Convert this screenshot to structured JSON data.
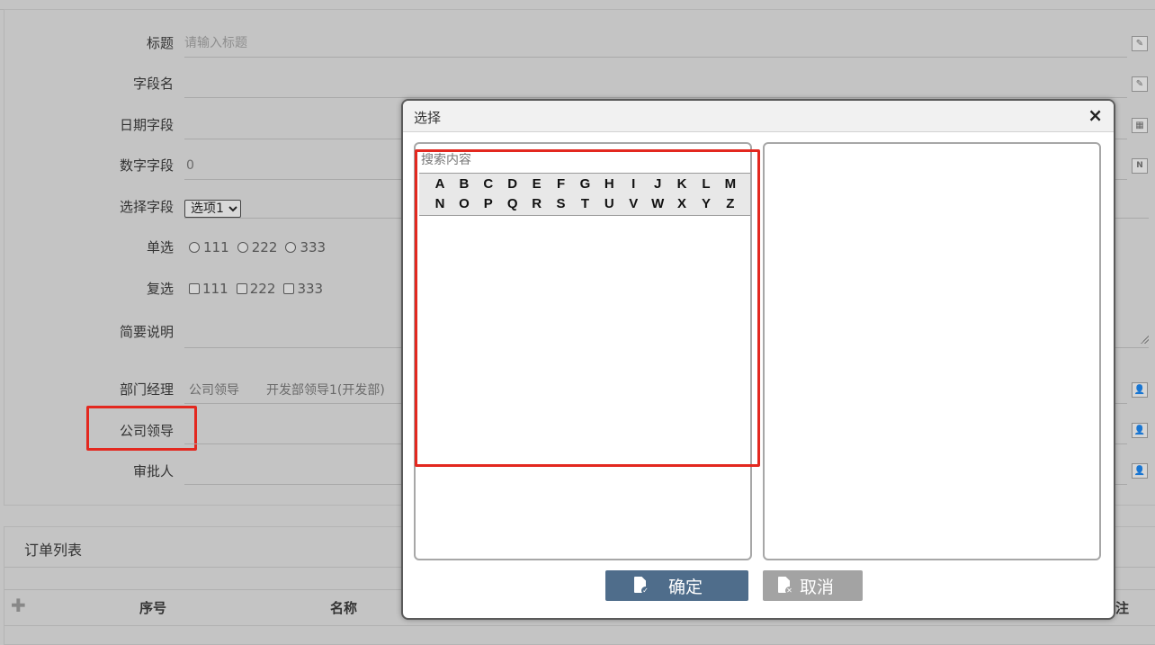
{
  "form": {
    "fields": [
      {
        "label": "标题",
        "placeholder": "请输入标题",
        "icon": "edit-icon"
      },
      {
        "label": "字段名",
        "value": "",
        "icon": "edit-icon"
      },
      {
        "label": "日期字段",
        "value": "",
        "icon": "calendar-icon"
      },
      {
        "label": "数字字段",
        "value": "0",
        "icon": "number-icon"
      },
      {
        "label": "选择字段",
        "select_value": "选项1"
      },
      {
        "label": "单选",
        "options": [
          "111",
          "222",
          "333"
        ]
      },
      {
        "label": "复选",
        "options": [
          "111",
          "222",
          "333"
        ]
      },
      {
        "label": "简要说明",
        "value": ""
      },
      {
        "label": "部门经理",
        "values": [
          "公司领导",
          "开发部领导1(开发部)"
        ],
        "icon": "user-icon"
      },
      {
        "label": "公司领导",
        "value": "",
        "icon": "user-icon"
      },
      {
        "label": "审批人",
        "value": "",
        "icon": "user-icon"
      }
    ]
  },
  "order_list": {
    "title": "订单列表",
    "columns": [
      "序号",
      "名称",
      "注"
    ]
  },
  "dialog": {
    "title": "选择",
    "close_glyph": "×",
    "search_placeholder": "搜索内容",
    "alphabet_row1": [
      "A",
      "B",
      "C",
      "D",
      "E",
      "F",
      "G",
      "H",
      "I",
      "J",
      "K",
      "L",
      "M"
    ],
    "alphabet_row2": [
      "N",
      "O",
      "P",
      "Q",
      "R",
      "S",
      "T",
      "U",
      "V",
      "W",
      "X",
      "Y",
      "Z"
    ],
    "ok_label": "确定",
    "cancel_label": "取消",
    "ok_color": "#4f6d8b",
    "cancel_color": "#a3a3a3"
  },
  "highlight_color": "#e3281f"
}
